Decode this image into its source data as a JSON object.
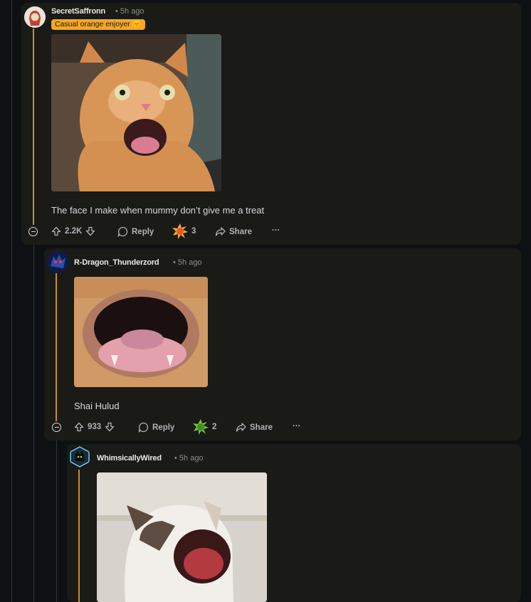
{
  "comments": [
    {
      "username": "SecretSaffronn",
      "timestamp": "• 5h ago",
      "flair": "Casual orange enjoyer 🌞",
      "text": "The face I make when mummy don’t give me a treat",
      "votes": "2.2K",
      "reply_label": "Reply",
      "award_count": "3",
      "share_label": "Share",
      "more_label": "···"
    },
    {
      "username": "R-Dragon_Thunderzord",
      "timestamp": "• 5h ago",
      "text": "Shai Hulud",
      "votes": "933",
      "reply_label": "Reply",
      "award_count": "2",
      "share_label": "Share",
      "more_label": "···"
    },
    {
      "username": "WhimsicallyWired",
      "timestamp": "• 5h ago"
    }
  ],
  "colors": {
    "page_bg": "#0e1113",
    "card_bg": "#1a1a17",
    "thread_accent": "#c8902d",
    "flair_bg": "#f5a623"
  },
  "icons": {
    "upvote": "arrow-up-icon",
    "downvote": "arrow-down-icon",
    "reply": "speech-bubble-icon",
    "share": "share-arrow-icon",
    "collapse": "minus-circle-icon"
  }
}
